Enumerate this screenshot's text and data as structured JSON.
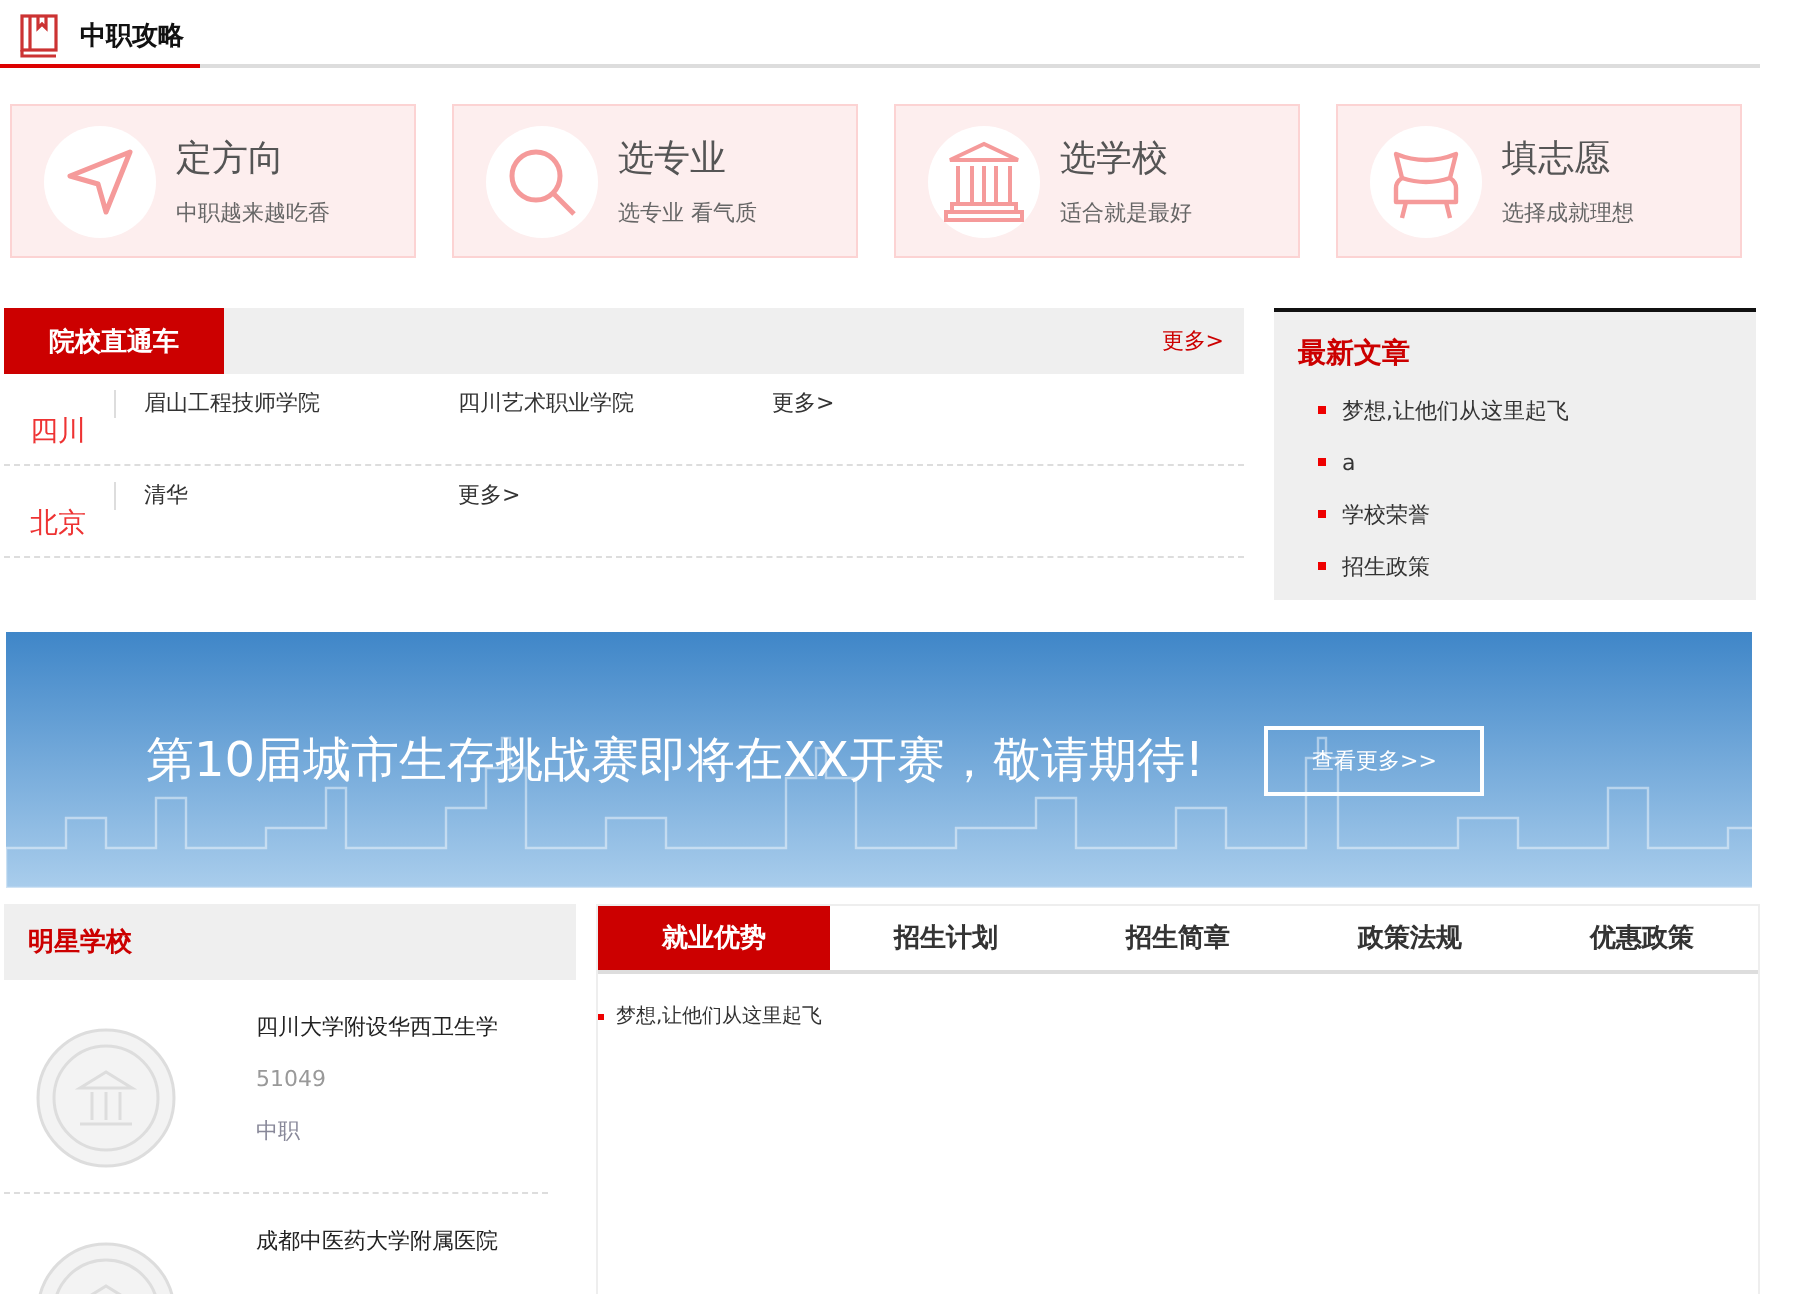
{
  "header": {
    "title": "中职攻略"
  },
  "guide_cards": [
    {
      "kind": "arrow",
      "title": "定方向",
      "subtitle": "中职越来越吃香"
    },
    {
      "kind": "search",
      "title": "选专业",
      "subtitle": "选专业 看气质"
    },
    {
      "kind": "building",
      "title": "选学校",
      "subtitle": "适合就是最好"
    },
    {
      "kind": "chair",
      "title": "填志愿",
      "subtitle": "选择成就理想"
    }
  ],
  "school_express": {
    "title": "院校直通车",
    "more": "更多>",
    "regions": [
      {
        "name": "四川",
        "schools": [
          "眉山工程技师学院",
          "四川艺术职业学院"
        ],
        "more": "更多>"
      },
      {
        "name": "北京",
        "schools": [
          "清华"
        ],
        "more": "更多>"
      }
    ]
  },
  "latest_articles": {
    "title": "最新文章",
    "items": [
      "梦想,让他们从这里起飞",
      "a",
      "学校荣誉",
      "招生政策"
    ]
  },
  "banner": {
    "headline": "第10届城市生存挑战赛即将在XX开赛，敬请期待!",
    "button": "查看更多>>"
  },
  "star_schools": {
    "title": "明星学校",
    "schools": [
      {
        "name": "四川大学附设华西卫生学",
        "code": "51049",
        "level": "中职"
      },
      {
        "name": "成都中医药大学附属医院"
      }
    ]
  },
  "info_tabs": {
    "tabs": [
      {
        "label": "就业优势",
        "selected": true
      },
      {
        "label": "招生计划",
        "selected": false
      },
      {
        "label": "招生简章",
        "selected": false
      },
      {
        "label": "政策法规",
        "selected": false
      },
      {
        "label": "优惠政策",
        "selected": false
      }
    ],
    "items": [
      "梦想,让他们从这里起飞"
    ]
  }
}
